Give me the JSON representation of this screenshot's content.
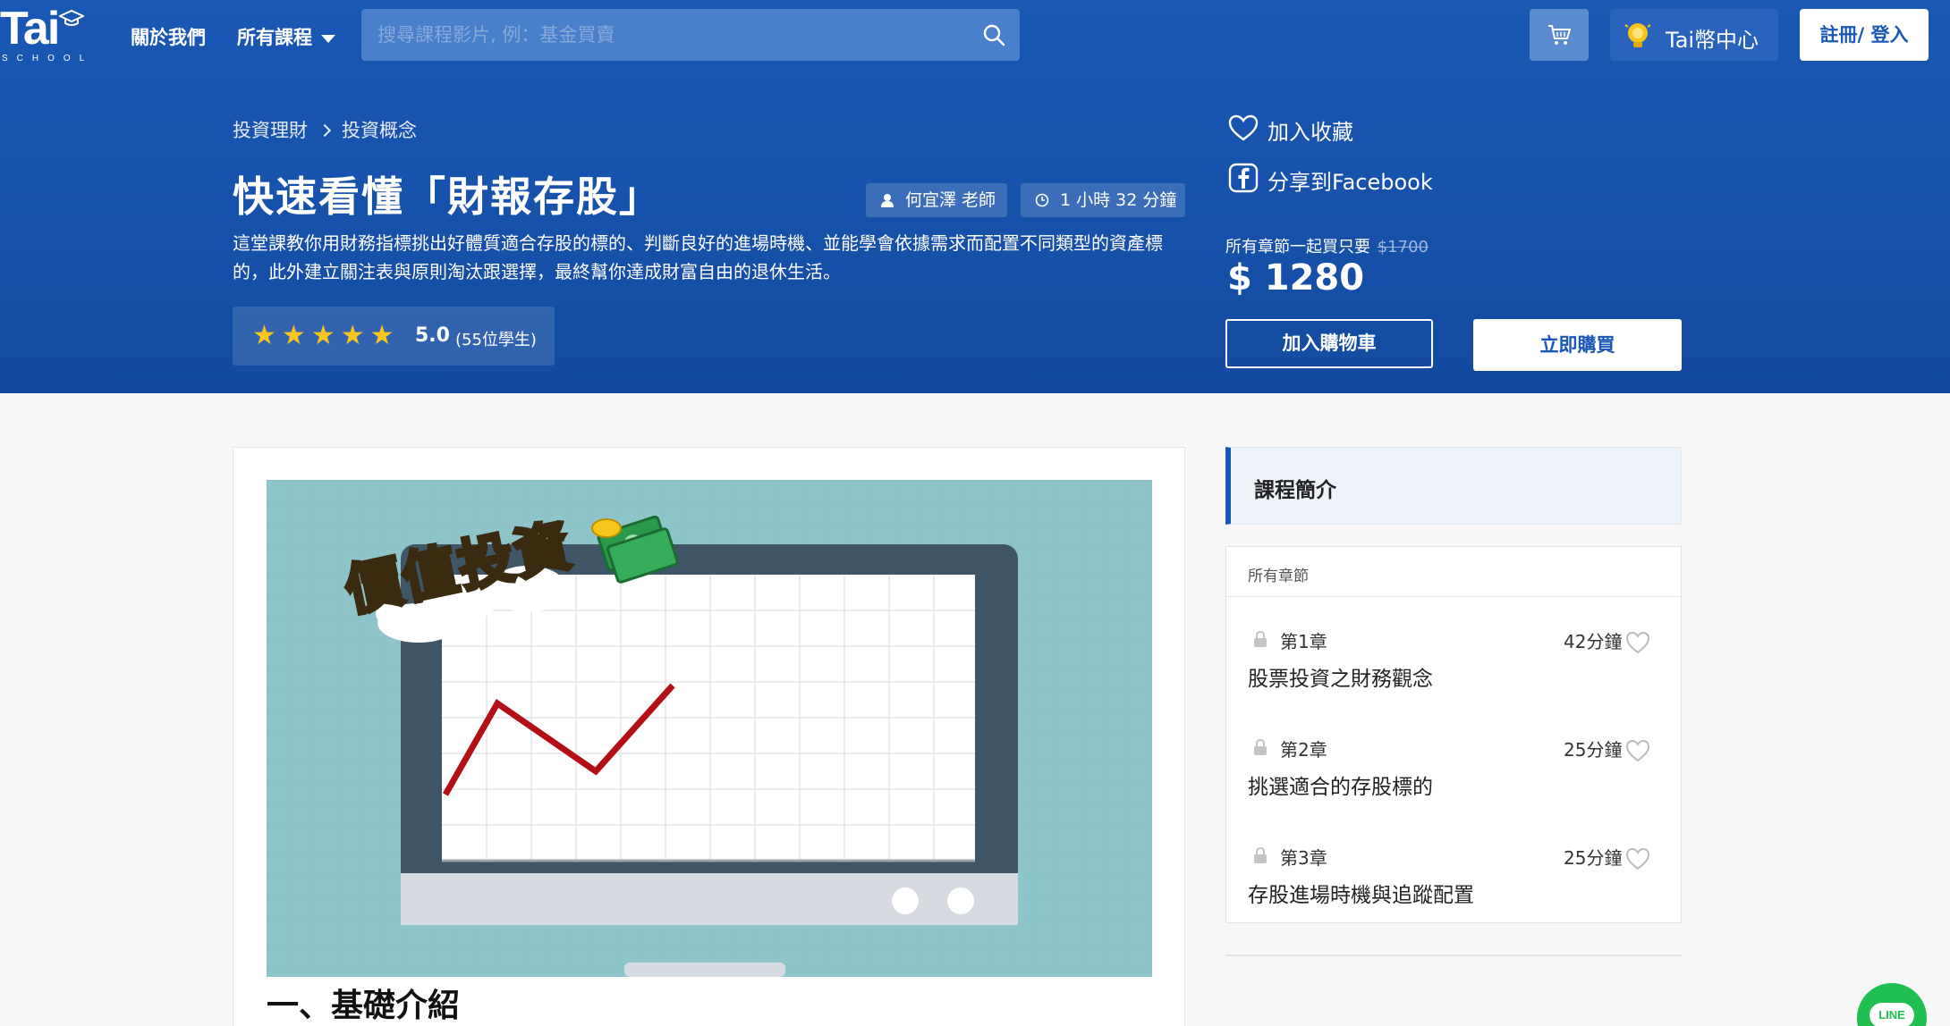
{
  "nav": {
    "logo_text": "Tai",
    "logo_sub": "SCHOOL",
    "about_label": "關於我們",
    "courses_label": "所有課程",
    "search_placeholder": "搜尋課程影片, 例：基金買賣",
    "coin_label": "Tai幣中心",
    "login_label": "註冊/ 登入"
  },
  "breadcrumb": [
    "投資理財",
    "投資概念"
  ],
  "course": {
    "title": "快速看懂「財報存股」",
    "teacher": "何宜澤 老師",
    "duration": "1 小時  32 分鐘",
    "description": "這堂課教你用財務指標挑出好體質適合存股的標的、判斷良好的進場時機、並能學會依據需求而配置不同類型的資產標的，此外建立關注表與原則淘汰跟選擇，最終幫你達成財富自由的退休生活。",
    "rating": {
      "stars": 5,
      "score": "5.0",
      "count_label": "(55位學生)"
    }
  },
  "actions": {
    "favorite_label": "加入收藏",
    "share_label": "分享到Facebook",
    "bundle_label": "所有章節一起買只要",
    "old_price": "$1700",
    "price": "$ 1280",
    "add_cart_label": "加入購物車",
    "buy_label": "立即購買"
  },
  "cover": {
    "title_art": "價值投資"
  },
  "main": {
    "section_heading": "一、基礎介紹"
  },
  "sidebar": {
    "title": "課程簡介",
    "chapters_header": "所有章節",
    "chapters": [
      {
        "num": "第1章",
        "duration": "42分鐘",
        "title": "股票投資之財務觀念"
      },
      {
        "num": "第2章",
        "duration": "25分鐘",
        "title": "挑選適合的存股標的"
      },
      {
        "num": "第3章",
        "duration": "25分鐘",
        "title": "存股進場時機與追蹤配置"
      }
    ]
  },
  "line_badge": "LINE",
  "colors": {
    "brand_blue": "#1a58b5",
    "star_yellow": "#f7c51c",
    "line_green": "#1fc04f"
  }
}
